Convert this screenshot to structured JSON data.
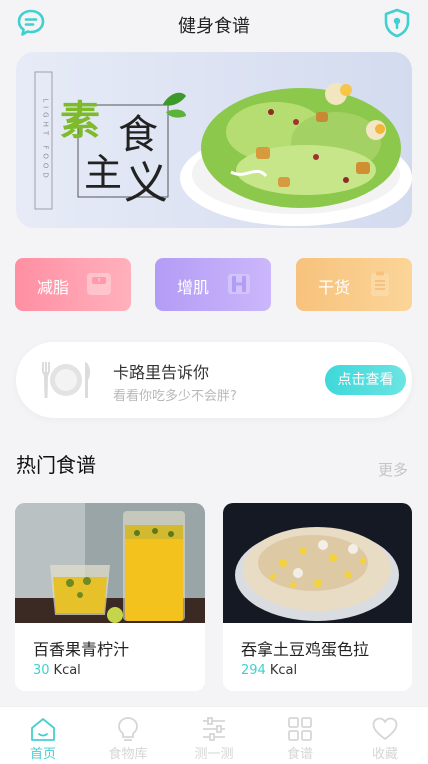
{
  "header": {
    "title": "健身食谱",
    "left_icon": "message-icon",
    "right_icon": "shield-icon"
  },
  "banner": {
    "title_chars": [
      "素",
      "食",
      "主",
      "义"
    ],
    "vertical_text": "LIGHT FOOD",
    "image": "salad-plate-image"
  },
  "categories": [
    {
      "label": "减脂",
      "icon": "scale-icon"
    },
    {
      "label": "增肌",
      "icon": "dumbbell-icon"
    },
    {
      "label": "干货",
      "icon": "clipboard-icon"
    }
  ],
  "calorie_card": {
    "title": "卡路里告诉你",
    "subtitle": "看看你吃多少不会胖?",
    "button": "点击查看",
    "icon": "plate-cutlery-icon"
  },
  "hot_section": {
    "title": "热门食谱",
    "more": "更多"
  },
  "recipes": [
    {
      "name": "百香果青柠汁",
      "kcal_value": "30",
      "kcal_unit": "Kcal"
    },
    {
      "name": "吞拿土豆鸡蛋色拉",
      "kcal_value": "294",
      "kcal_unit": "Kcal"
    }
  ],
  "tabbar": {
    "items": [
      {
        "label": "首页",
        "icon": "home-icon"
      },
      {
        "label": "食物库",
        "icon": "lightbulb-icon"
      },
      {
        "label": "测一测",
        "icon": "sliders-icon"
      },
      {
        "label": "食谱",
        "icon": "grid-icon"
      },
      {
        "label": "收藏",
        "icon": "heart-icon"
      }
    ],
    "active_index": 0
  },
  "colors": {
    "accent": "#3fd0cf",
    "background": "#f4f4f6",
    "pink": "#ff8fa3",
    "purple": "#b39cf5",
    "orange": "#f7c27d"
  }
}
